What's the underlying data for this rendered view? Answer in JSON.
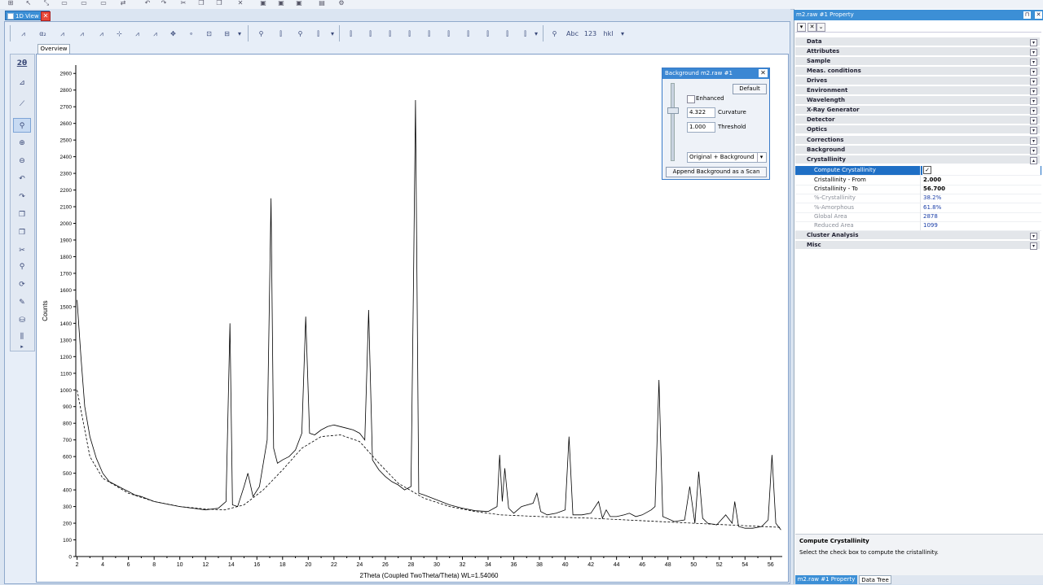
{
  "document_tab": {
    "label": "1D View"
  },
  "view_tabs": {
    "overview": "Overview"
  },
  "left_tools": {
    "two_theta": "2θ"
  },
  "chart_data": {
    "type": "line",
    "xlabel": "2Theta (Coupled TwoTheta/Theta) WL=1.54060",
    "ylabel": "Counts",
    "xlim": [
      1.9,
      56.9
    ],
    "ylim": [
      0,
      2950
    ],
    "x_ticks": [
      2,
      4,
      6,
      8,
      10,
      12,
      14,
      16,
      18,
      20,
      22,
      24,
      26,
      28,
      30,
      32,
      34,
      36,
      38,
      40,
      42,
      44,
      46,
      48,
      50,
      52,
      54,
      56
    ],
    "y_ticks": [
      0,
      100,
      200,
      300,
      400,
      500,
      600,
      700,
      800,
      900,
      1000,
      1100,
      1200,
      1300,
      1400,
      1500,
      1600,
      1700,
      1800,
      1900,
      2000,
      2100,
      2200,
      2300,
      2400,
      2500,
      2600,
      2700,
      2800,
      2900
    ],
    "series": [
      {
        "style": "solid",
        "x": [
          2.0,
          2.3,
          2.6,
          3.0,
          3.5,
          4.0,
          4.5,
          5.0,
          5.5,
          6.0,
          6.5,
          7.0,
          8.0,
          9.0,
          10.0,
          11.0,
          12.0,
          13.0,
          13.6,
          13.9,
          14.1,
          14.5,
          15.0,
          15.3,
          15.7,
          16.2,
          16.8,
          17.1,
          17.3,
          17.6,
          18.0,
          18.5,
          19.0,
          19.5,
          19.8,
          20.1,
          20.5,
          21.0,
          21.5,
          22.0,
          22.5,
          23.0,
          23.5,
          24.0,
          24.4,
          24.7,
          25.0,
          25.5,
          26.0,
          26.5,
          27.0,
          27.5,
          28.0,
          28.2,
          28.35,
          28.6,
          29.0,
          30.0,
          31.0,
          32.0,
          33.0,
          34.0,
          34.7,
          34.9,
          35.1,
          35.3,
          35.6,
          36.0,
          36.6,
          37.5,
          37.8,
          38.1,
          38.6,
          39.3,
          40.0,
          40.3,
          40.6,
          41.3,
          42.0,
          42.6,
          42.9,
          43.2,
          43.5,
          44.0,
          44.6,
          45.0,
          45.5,
          46.0,
          46.7,
          47.0,
          47.3,
          47.6,
          48.5,
          49.3,
          49.7,
          50.1,
          50.4,
          50.7,
          51.1,
          51.8,
          52.5,
          53.0,
          53.2,
          53.5,
          54.0,
          54.6,
          55.3,
          55.8,
          56.1,
          56.4,
          56.8
        ],
        "y": [
          1540,
          1200,
          900,
          720,
          590,
          500,
          450,
          430,
          410,
          390,
          370,
          360,
          330,
          315,
          300,
          290,
          280,
          290,
          330,
          1400,
          310,
          300,
          420,
          500,
          360,
          420,
          700,
          2150,
          650,
          560,
          580,
          600,
          640,
          740,
          1440,
          740,
          730,
          760,
          780,
          790,
          780,
          770,
          760,
          740,
          700,
          1480,
          580,
          520,
          480,
          450,
          430,
          400,
          420,
          1700,
          2740,
          380,
          370,
          340,
          310,
          290,
          275,
          270,
          300,
          610,
          330,
          530,
          290,
          260,
          300,
          320,
          380,
          270,
          250,
          260,
          280,
          720,
          250,
          250,
          260,
          330,
          230,
          280,
          240,
          240,
          250,
          260,
          240,
          250,
          280,
          300,
          1060,
          240,
          210,
          220,
          420,
          200,
          510,
          230,
          200,
          190,
          250,
          200,
          330,
          180,
          170,
          170,
          180,
          220,
          610,
          200,
          160
        ]
      },
      {
        "style": "dashed",
        "x": [
          2.0,
          3.0,
          4.0,
          6.0,
          8.0,
          10.0,
          12.0,
          13.5,
          15.0,
          16.5,
          18.0,
          19.5,
          21.0,
          22.5,
          24.0,
          25.5,
          27.0,
          29.0,
          31.0,
          33.0,
          35.0,
          38.0,
          42.0,
          46.0,
          50.0,
          54.0,
          56.8
        ],
        "y": [
          1000,
          600,
          470,
          380,
          330,
          300,
          285,
          280,
          310,
          400,
          520,
          650,
          720,
          730,
          690,
          560,
          440,
          350,
          300,
          270,
          250,
          240,
          230,
          215,
          200,
          185,
          175
        ]
      }
    ]
  },
  "background_dialog": {
    "title": "Background m2.raw #1",
    "default_label": "Default",
    "enhanced_label": "Enhanced",
    "curvature_value": "4.322",
    "curvature_label": "Curvature",
    "threshold_value": "1.000",
    "threshold_label": "Threshold",
    "mode_value": "Original + Background",
    "append_label": "Append Background as a Scan"
  },
  "property_panel": {
    "title": "m2.raw #1 Property",
    "categories_top": [
      "Data",
      "Attributes",
      "Sample",
      "Meas. conditions",
      "Drives",
      "Environment",
      "Wavelength",
      "X-Ray Generator",
      "Detector",
      "Optics",
      "Corrections",
      "Background",
      "Crystallinity"
    ],
    "crystallinity": {
      "compute": {
        "key": "Compute Crystallinity",
        "value": "✓"
      },
      "from": {
        "key": "Cristallinity - From",
        "value": "2.000"
      },
      "to": {
        "key": "Cristallinity - To",
        "value": "56.700"
      },
      "pct_cryst": {
        "key": "%-Crystallinity",
        "value": "38.2%"
      },
      "pct_amorph": {
        "key": "%-Amorphous",
        "value": "61.8%"
      },
      "global_area": {
        "key": "Global Area",
        "value": "2878"
      },
      "reduced_area": {
        "key": "Reduced Area",
        "value": "1099"
      }
    },
    "categories_bottom": [
      "Cluster Analysis",
      "Misc"
    ],
    "help_title": "Compute Crystallinity",
    "help_text": "Select the check box to compute the cristallinity.",
    "bottom_tab_property": "m2.raw #1 Property",
    "bottom_tab_tree": "Data Tree"
  }
}
